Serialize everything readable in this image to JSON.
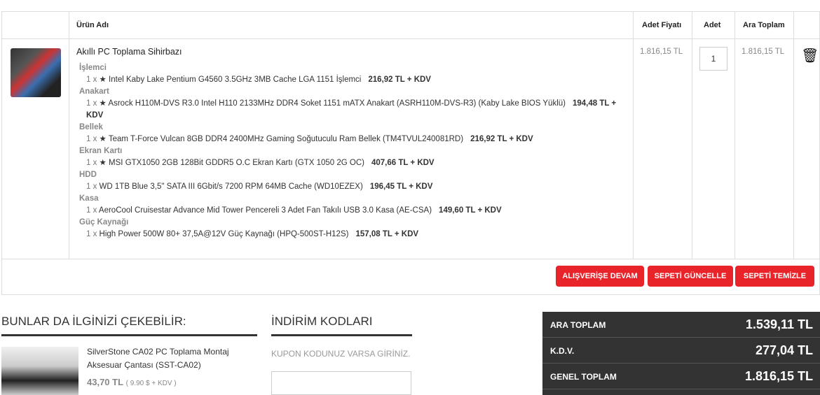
{
  "table": {
    "headers": {
      "product": "Ürün Adı",
      "unit_price": "Adet Fiyatı",
      "qty": "Adet",
      "subtotal": "Ara Toplam"
    },
    "product": {
      "title": "Akıllı PC Toplama Sihirbazı",
      "unit_price": "1.816,15 TL",
      "qty": "1",
      "subtotal": "1.816,15 TL",
      "components": [
        {
          "category": "İşlemci",
          "qty": "1 x",
          "name": "★ Intel Kaby Lake Pentium G4560 3.5GHz 3MB Cache LGA 1151 İşlemci",
          "price": "216,92 TL + KDV"
        },
        {
          "category": "Anakart",
          "qty": "1 x",
          "name": "★ Asrock H110M-DVS R3.0 Intel H110 2133MHz DDR4 Soket 1151 mATX Anakart (ASRH110M-DVS-R3) (Kaby Lake BIOS Yüklü)",
          "price": "194,48 TL + KDV"
        },
        {
          "category": "Bellek",
          "qty": "1 x",
          "name": "★ Team T-Force Vulcan 8GB DDR4 2400MHz Gaming Soğutuculu Ram Bellek (TM4TVUL240081RD)",
          "price": "216,92 TL + KDV"
        },
        {
          "category": "Ekran Kartı",
          "qty": "1 x",
          "name": "★ MSI GTX1050 2GB 128Bit GDDR5 O.C Ekran Kartı (GTX 1050 2G OC)",
          "price": "407,66 TL + KDV"
        },
        {
          "category": "HDD",
          "qty": "1 x",
          "name": "WD 1TB Blue 3,5\" SATA III 6Gbit/s 7200 RPM 64MB Cache (WD10EZEX)",
          "price": "196,45 TL + KDV"
        },
        {
          "category": "Kasa",
          "qty": "1 x",
          "name": "AeroCool Cruisestar Advance Mid Tower Pencereli 3 Adet Fan Takılı USB 3.0 Kasa (AE-CSA)",
          "price": "149,60 TL + KDV"
        },
        {
          "category": "Güç Kaynağı",
          "qty": "1 x",
          "name": "High Power 500W 80+ 37,5A@12V Güç Kaynağı (HPQ-500ST-H12S)",
          "price": "157,08 TL + KDV"
        }
      ]
    }
  },
  "buttons": {
    "continue": "ALIŞVERİŞE DEVAM",
    "update": "SEPETİ GÜNCELLE",
    "clear": "SEPETİ TEMİZLE"
  },
  "suggest": {
    "title": "BUNLAR DA İLGİNİZİ ÇEKEBİLİR:",
    "name": "SilverStone CA02 PC Toplama Montaj Aksesuar Çantası (SST-CA02)",
    "price": "43,70 TL",
    "price_note": "( 9.90 $ + KDV )"
  },
  "coupon": {
    "title": "İNDİRİM KODLARI",
    "label": "KUPON KODUNUZ VARSA GİRİNİZ.",
    "value": ""
  },
  "totals": [
    {
      "label": "ARA TOPLAM",
      "value": "1.539,11 TL"
    },
    {
      "label": "K.D.V.",
      "value": "277,04 TL"
    },
    {
      "label": "GENEL TOPLAM",
      "value": "1.816,15 TL"
    }
  ],
  "colors": {
    "accent": "#e8232a",
    "totals_bg": "#333333"
  }
}
